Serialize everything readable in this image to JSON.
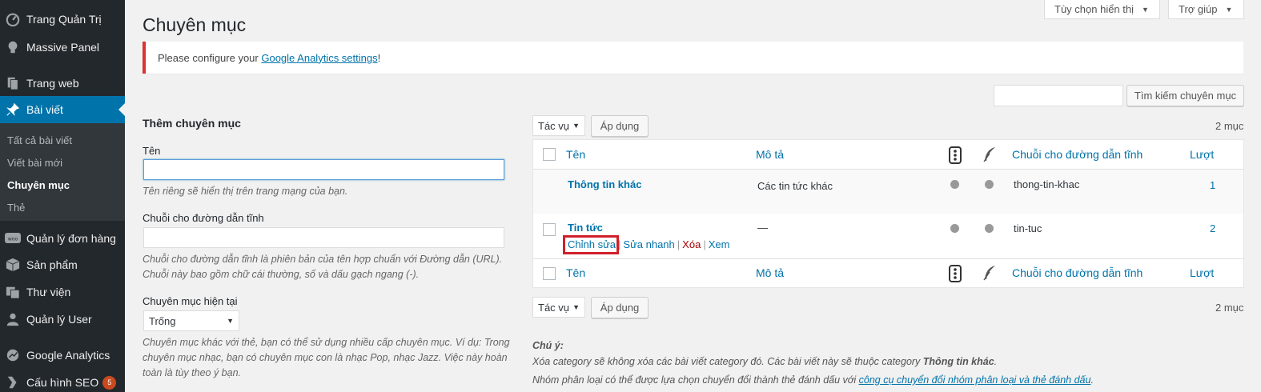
{
  "sidebar": {
    "items": [
      {
        "label": "Trang Quản Trị",
        "icon": "dashboard-icon"
      },
      {
        "label": "Massive Panel",
        "icon": "lightbulb-icon"
      },
      {
        "label": "Trang web",
        "icon": "pages-icon"
      },
      {
        "label": "Bài viết",
        "icon": "pin-icon"
      },
      {
        "label": "Quản lý đơn hàng",
        "icon": "woo-icon"
      },
      {
        "label": "Sản phẩm",
        "icon": "box-icon"
      },
      {
        "label": "Thư viện",
        "icon": "media-icon"
      },
      {
        "label": "Quản lý User",
        "icon": "user-icon"
      },
      {
        "label": "Google Analytics",
        "icon": "analytics-icon"
      },
      {
        "label": "Cấu hình SEO",
        "icon": "seo-icon",
        "badge": "5"
      }
    ],
    "submenu": [
      "Tất cả bài viết",
      "Viết bài mới",
      "Chuyên mục",
      "Thẻ"
    ]
  },
  "top": {
    "screen_options": "Tùy chọn hiển thị",
    "help": "Trợ giúp"
  },
  "page_title": "Chuyên mục",
  "notice": {
    "prefix": "Please configure your ",
    "link": "Google Analytics settings",
    "suffix": "!"
  },
  "search": {
    "button": "Tìm kiếm chuyên mục"
  },
  "form": {
    "heading": "Thêm chuyên mục",
    "name_label": "Tên",
    "name_help": "Tên riêng sẽ hiển thị trên trang mạng của bạn.",
    "slug_label": "Chuỗi cho đường dẫn tĩnh",
    "slug_help": "Chuỗi cho đường dẫn tĩnh là phiên bản của tên hợp chuẩn với Đường dẫn (URL). Chuỗi này bao gồm chữ cái thường, số và dấu gạch ngang (-).",
    "parent_label": "Chuyên mục hiện tại",
    "parent_value": "Trống",
    "parent_help": "Chuyên mục khác với thẻ, bạn có thể sử dụng nhiều cấp chuyên mục. Ví dụ: Trong chuyên mục nhạc, bạn có chuyên mục con là nhạc Pop, nhạc Jazz. Việc này hoàn toàn là tùy theo ý bạn."
  },
  "bulk": {
    "action": "Tác vụ",
    "apply": "Áp dụng",
    "count": "2 mục"
  },
  "table": {
    "headers": {
      "name": "Tên",
      "description": "Mô tả",
      "slug": "Chuỗi cho đường dẫn tĩnh",
      "count": "Lượt"
    },
    "rows": [
      {
        "name": "Thông tin khác",
        "description": "Các tin tức khác",
        "slug": "thong-tin-khac",
        "count": "1"
      },
      {
        "name": "Tin tức",
        "description": "—",
        "slug": "tin-tuc",
        "count": "2"
      }
    ],
    "row_actions": {
      "edit": "Chỉnh sửa",
      "quick_edit": "Sửa nhanh",
      "delete": "Xóa",
      "view": "Xem",
      "sep": "|"
    }
  },
  "note": {
    "title": "Chú ý:",
    "line1_prefix": "Xóa category sẽ không xóa các bài viết category đó. Các bài viết này sẽ thuộc category ",
    "line1_bold": "Thông tin khác",
    "line1_suffix": ".",
    "line2_prefix": "Nhóm phân loại có thể được lựa chọn chuyển đổi thành thẻ đánh dấu với ",
    "line2_link": "công cụ chuyển đổi nhóm phân loại và thẻ đánh dấu",
    "line2_suffix": "."
  }
}
